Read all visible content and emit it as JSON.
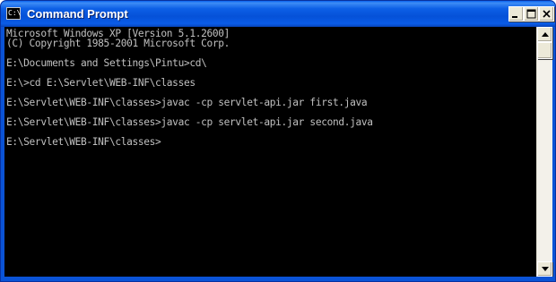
{
  "window": {
    "title": "Command Prompt",
    "icon": "console-icon",
    "icon_glyph": "C:\\"
  },
  "titlebar_buttons": [
    {
      "name": "minimize",
      "icon": "minimize-icon"
    },
    {
      "name": "maximize",
      "icon": "maximize-icon"
    },
    {
      "name": "close",
      "icon": "close-icon"
    }
  ],
  "console": {
    "lines": [
      "Microsoft Windows XP [Version 5.1.2600]",
      "(C) Copyright 1985-2001 Microsoft Corp.",
      "",
      "E:\\Documents and Settings\\Pintu>cd\\",
      "",
      "E:\\>cd E:\\Servlet\\WEB-INF\\classes",
      "",
      "E:\\Servlet\\WEB-INF\\classes>javac -cp servlet-api.jar first.java",
      "",
      "E:\\Servlet\\WEB-INF\\classes>javac -cp servlet-api.jar second.java",
      "",
      "E:\\Servlet\\WEB-INF\\classes>"
    ],
    "text_color": "#c0c0c0",
    "background_color": "#000000"
  },
  "scrollbar": {
    "up_icon": "arrow-up-icon",
    "down_icon": "arrow-down-icon"
  },
  "colors": {
    "titlebar": "#0a5ce8",
    "button_face": "#ece9d8"
  }
}
